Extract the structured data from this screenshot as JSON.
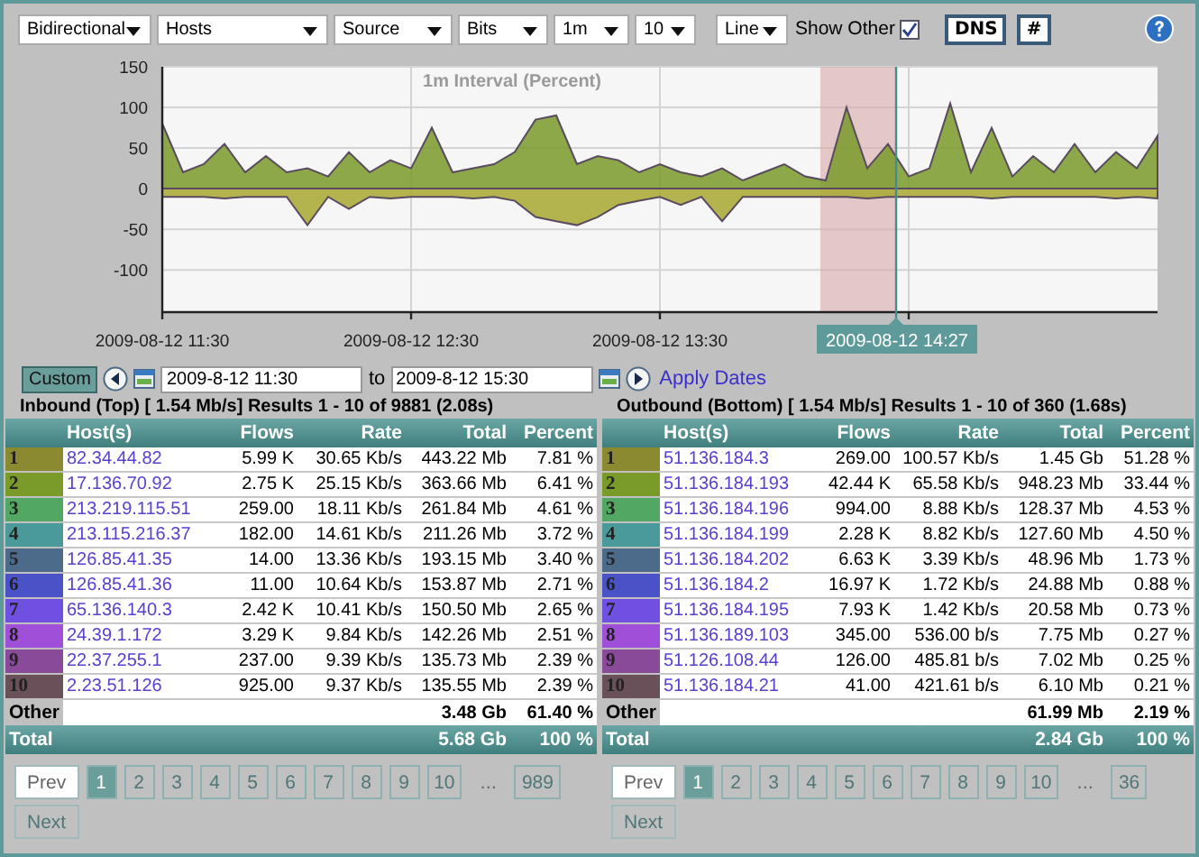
{
  "toolbar": {
    "dropdowns": [
      {
        "value": "Bidirectional"
      },
      {
        "value": "Hosts"
      },
      {
        "value": "Source"
      },
      {
        "value": "Bits"
      },
      {
        "value": "1m"
      },
      {
        "value": "10"
      },
      {
        "value": "Line"
      }
    ],
    "show_other": {
      "label": "Show Other",
      "checked": true
    },
    "buttons": [
      "DNS",
      "#"
    ]
  },
  "chart": {
    "tooltip": "2009-08-12 14:27",
    "chart_data": {
      "type": "area",
      "title": "1m Interval (Percent)",
      "categories": [
        "2009-08-12 11:30",
        null,
        null,
        null,
        null,
        null,
        null,
        null,
        null,
        null,
        null,
        null,
        "2009-08-12 12:30",
        null,
        null,
        null,
        null,
        null,
        null,
        null,
        null,
        null,
        null,
        null,
        "2009-08-12 13:30",
        null,
        null,
        null,
        null,
        null,
        null,
        null,
        null,
        null,
        null,
        null,
        null,
        null,
        null,
        null,
        null,
        null,
        null,
        null,
        null,
        null,
        null,
        null,
        null
      ],
      "series": [
        {
          "color": "#7a9a2a",
          "values": [
            80,
            20,
            30,
            55,
            20,
            40,
            20,
            25,
            15,
            45,
            20,
            35,
            25,
            75,
            20,
            25,
            30,
            45,
            85,
            90,
            30,
            40,
            35,
            20,
            30,
            20,
            15,
            25,
            10,
            20,
            30,
            15,
            10,
            100,
            25,
            55,
            15,
            25,
            105,
            20,
            75,
            15,
            40,
            20,
            55,
            20,
            45,
            25,
            65
          ]
        },
        {
          "color": "#a8a830",
          "values": [
            -10,
            -10,
            -10,
            -12,
            -10,
            -10,
            -10,
            -45,
            -10,
            -25,
            -10,
            -12,
            -10,
            -10,
            -10,
            -12,
            -10,
            -15,
            -35,
            -40,
            -45,
            -35,
            -20,
            -15,
            -10,
            -20,
            -10,
            -40,
            -10,
            -10,
            -10,
            -10,
            -10,
            -10,
            -12,
            -10,
            -10,
            -10,
            -10,
            -10,
            -12,
            -10,
            -10,
            -10,
            -10,
            -10,
            -12,
            -10,
            -12
          ]
        }
      ],
      "ylim": [
        -152,
        150
      ],
      "grid": true,
      "yticks": [
        150,
        100,
        50,
        0,
        -50,
        -100
      ]
    }
  },
  "date_range": {
    "button": "Custom",
    "from": "2009-8-12 11:30",
    "to_label": "to",
    "to": "2009-8-12 15:30",
    "apply": "Apply Dates"
  },
  "tables": [
    {
      "title": "Inbound (Top) [ 1.54 Mb/s] Results 1 - 10 of 9881 (2.08s)",
      "columns": [
        "Host(s)",
        "Flows",
        "Rate",
        "Total",
        "Percent"
      ],
      "rows": [
        {
          "index": "1",
          "host": "82.34.44.82",
          "flows": "5.99 K",
          "rate": "30.65 Kb/s",
          "total": "443.22 Mb",
          "percent": "7.81 %",
          "color": "#8c8a30"
        },
        {
          "index": "2",
          "host": "17.136.70.92",
          "flows": "2.75 K",
          "rate": "25.15 Kb/s",
          "total": "363.66 Mb",
          "percent": "6.41 %",
          "color": "#7a9a2a"
        },
        {
          "index": "3",
          "host": "213.219.115.51",
          "flows": "259.00",
          "rate": "18.11 Kb/s",
          "total": "261.84 Mb",
          "percent": "4.61 %",
          "color": "#52a862"
        },
        {
          "index": "4",
          "host": "213.115.216.37",
          "flows": "182.00",
          "rate": "14.61 Kb/s",
          "total": "211.26 Mb",
          "percent": "3.72 %",
          "color": "#4a9a9c"
        },
        {
          "index": "5",
          "host": "126.85.41.35",
          "flows": "14.00",
          "rate": "13.36 Kb/s",
          "total": "193.15 Mb",
          "percent": "3.40 %",
          "color": "#4c6a8a"
        },
        {
          "index": "6",
          "host": "126.85.41.36",
          "flows": "11.00",
          "rate": "10.64 Kb/s",
          "total": "153.87 Mb",
          "percent": "2.71 %",
          "color": "#4a52c8"
        },
        {
          "index": "7",
          "host": "65.136.140.3",
          "flows": "2.42 K",
          "rate": "10.41 Kb/s",
          "total": "150.50 Mb",
          "percent": "2.65 %",
          "color": "#7050e0"
        },
        {
          "index": "8",
          "host": "24.39.1.172",
          "flows": "3.29 K",
          "rate": "9.84 Kb/s",
          "total": "142.26 Mb",
          "percent": "2.51 %",
          "color": "#a050d8"
        },
        {
          "index": "9",
          "host": "22.37.255.1",
          "flows": "237.00",
          "rate": "9.39 Kb/s",
          "total": "135.73 Mb",
          "percent": "2.39 %",
          "color": "#8a4a9a"
        },
        {
          "index": "10",
          "host": "2.23.51.126",
          "flows": "925.00",
          "rate": "9.37 Kb/s",
          "total": "135.55 Mb",
          "percent": "2.39 %",
          "color": "#6a5058"
        }
      ],
      "other": {
        "label": "Other",
        "total": "3.48 Gb",
        "percent": "61.40 %"
      },
      "total": {
        "label": "Total",
        "total": "5.68 Gb",
        "percent": "100 %"
      },
      "pagination": {
        "prev": {
          "label": "Prev",
          "disabled": false
        },
        "next": {
          "label": "Next",
          "disabled": true
        },
        "pages": [
          {
            "kind": "page",
            "label": "1",
            "selected": true
          },
          {
            "kind": "page",
            "label": "2",
            "selected": false
          },
          {
            "kind": "page",
            "label": "3",
            "selected": false
          },
          {
            "kind": "page",
            "label": "4",
            "selected": false
          },
          {
            "kind": "page",
            "label": "5",
            "selected": false
          },
          {
            "kind": "page",
            "label": "6",
            "selected": false
          },
          {
            "kind": "page",
            "label": "7",
            "selected": false
          },
          {
            "kind": "page",
            "label": "8",
            "selected": false
          },
          {
            "kind": "page",
            "label": "9",
            "selected": false
          },
          {
            "kind": "page",
            "label": "10",
            "selected": false
          },
          {
            "kind": "ellipsis",
            "label": "..."
          },
          {
            "kind": "page",
            "label": "989",
            "selected": false
          }
        ]
      }
    },
    {
      "title": "Outbound (Bottom) [ 1.54 Mb/s] Results 1 - 10 of 360 (1.68s)",
      "columns": [
        "Host(s)",
        "Flows",
        "Rate",
        "Total",
        "Percent"
      ],
      "rows": [
        {
          "index": "1",
          "host": "51.136.184.3",
          "flows": "269.00",
          "rate": "100.57 Kb/s",
          "total": "1.45 Gb",
          "percent": "51.28 %",
          "color": "#8c8a30"
        },
        {
          "index": "2",
          "host": "51.136.184.193",
          "flows": "42.44 K",
          "rate": "65.58 Kb/s",
          "total": "948.23 Mb",
          "percent": "33.44 %",
          "color": "#7a9a2a"
        },
        {
          "index": "3",
          "host": "51.136.184.196",
          "flows": "994.00",
          "rate": "8.88 Kb/s",
          "total": "128.37 Mb",
          "percent": "4.53 %",
          "color": "#52a862"
        },
        {
          "index": "4",
          "host": "51.136.184.199",
          "flows": "2.28 K",
          "rate": "8.82 Kb/s",
          "total": "127.60 Mb",
          "percent": "4.50 %",
          "color": "#4a9a9c"
        },
        {
          "index": "5",
          "host": "51.136.184.202",
          "flows": "6.63 K",
          "rate": "3.39 Kb/s",
          "total": "48.96 Mb",
          "percent": "1.73 %",
          "color": "#4c6a8a"
        },
        {
          "index": "6",
          "host": "51.136.184.2",
          "flows": "16.97 K",
          "rate": "1.72 Kb/s",
          "total": "24.88 Mb",
          "percent": "0.88 %",
          "color": "#4a52c8"
        },
        {
          "index": "7",
          "host": "51.136.184.195",
          "flows": "7.93 K",
          "rate": "1.42 Kb/s",
          "total": "20.58 Mb",
          "percent": "0.73 %",
          "color": "#7050e0"
        },
        {
          "index": "8",
          "host": "51.136.189.103",
          "flows": "345.00",
          "rate": "536.00 b/s",
          "total": "7.75 Mb",
          "percent": "0.27 %",
          "color": "#a050d8"
        },
        {
          "index": "9",
          "host": "51.126.108.44",
          "flows": "126.00",
          "rate": "485.81 b/s",
          "total": "7.02 Mb",
          "percent": "0.25 %",
          "color": "#8a4a9a"
        },
        {
          "index": "10",
          "host": "51.136.184.21",
          "flows": "41.00",
          "rate": "421.61 b/s",
          "total": "6.10 Mb",
          "percent": "0.21 %",
          "color": "#6a5058"
        }
      ],
      "other": {
        "label": "Other",
        "total": "61.99 Mb",
        "percent": "2.19 %"
      },
      "total": {
        "label": "Total",
        "total": "2.84 Gb",
        "percent": "100 %"
      },
      "pagination": {
        "prev": {
          "label": "Prev",
          "disabled": false
        },
        "next": {
          "label": "Next",
          "disabled": true
        },
        "pages": [
          {
            "kind": "page",
            "label": "1",
            "selected": true
          },
          {
            "kind": "page",
            "label": "2",
            "selected": false
          },
          {
            "kind": "page",
            "label": "3",
            "selected": false
          },
          {
            "kind": "page",
            "label": "4",
            "selected": false
          },
          {
            "kind": "page",
            "label": "5",
            "selected": false
          },
          {
            "kind": "page",
            "label": "6",
            "selected": false
          },
          {
            "kind": "page",
            "label": "7",
            "selected": false
          },
          {
            "kind": "page",
            "label": "8",
            "selected": false
          },
          {
            "kind": "page",
            "label": "9",
            "selected": false
          },
          {
            "kind": "page",
            "label": "10",
            "selected": false
          },
          {
            "kind": "ellipsis",
            "label": "..."
          },
          {
            "kind": "page",
            "label": "36",
            "selected": false
          }
        ]
      }
    }
  ]
}
